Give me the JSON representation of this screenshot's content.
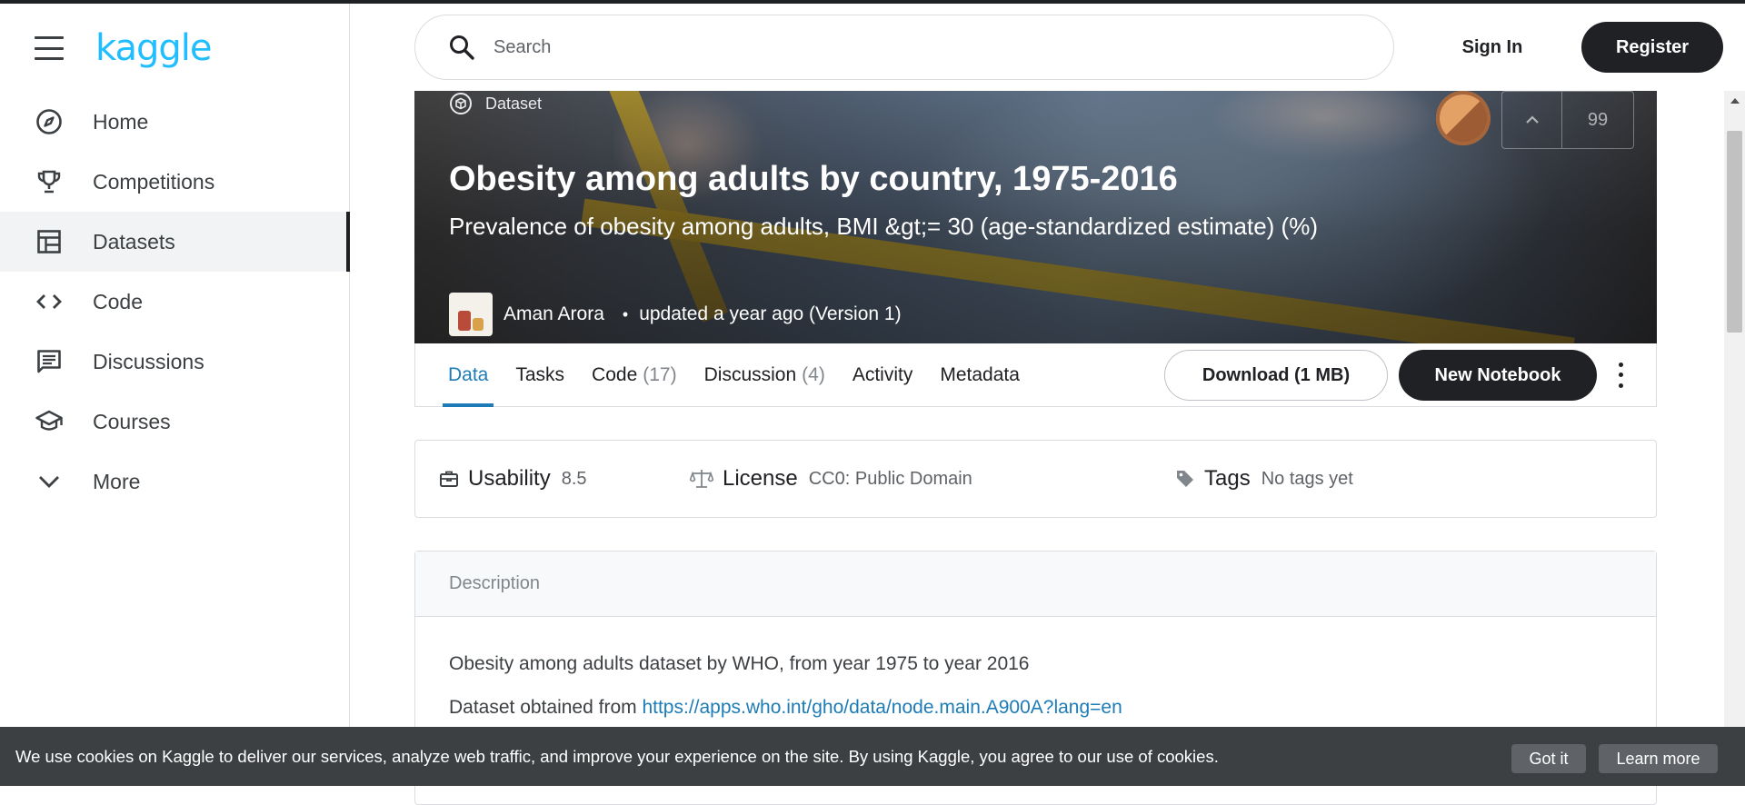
{
  "brand": {
    "logo_text": "kaggle",
    "accent": "#20beff"
  },
  "sidebar": {
    "items": [
      {
        "label": "Home",
        "icon": "compass-icon"
      },
      {
        "label": "Competitions",
        "icon": "trophy-icon"
      },
      {
        "label": "Datasets",
        "icon": "table-icon",
        "active": true
      },
      {
        "label": "Code",
        "icon": "code-icon"
      },
      {
        "label": "Discussions",
        "icon": "comment-icon"
      },
      {
        "label": "Courses",
        "icon": "school-icon"
      },
      {
        "label": "More",
        "icon": "chevron-down-icon"
      }
    ]
  },
  "header": {
    "search_placeholder": "Search",
    "sign_in_label": "Sign In",
    "register_label": "Register"
  },
  "dataset": {
    "type_label": "Dataset",
    "title": "Obesity among adults by country, 1975-2016",
    "subtitle": "Prevalence of obesity among adults, BMI &gt;= 30 (age-standardized estimate) (%)",
    "author": "Aman Arora",
    "bullet": "•",
    "updated": "updated a year ago (Version 1)",
    "medal": "bronze-medal-icon",
    "votes": "99"
  },
  "tabs": [
    {
      "label": "Data",
      "count": "",
      "active": true
    },
    {
      "label": "Tasks",
      "count": ""
    },
    {
      "label": "Code",
      "count": "(17)"
    },
    {
      "label": "Discussion",
      "count": "(4)"
    },
    {
      "label": "Activity",
      "count": ""
    },
    {
      "label": "Metadata",
      "count": ""
    }
  ],
  "actions": {
    "download_label": "Download (1 MB)",
    "notebook_label": "New Notebook"
  },
  "info": {
    "usability_label": "Usability",
    "usability_value": "8.5",
    "license_label": "License",
    "license_value": "CC0: Public Domain",
    "tags_label": "Tags",
    "tags_value": "No tags yet"
  },
  "description": {
    "heading": "Description",
    "line1": "Obesity among adults dataset by WHO, from year 1975 to year 2016",
    "line2_prefix": "Dataset obtained from ",
    "line2_link": "https://apps.who.int/gho/data/node.main.A900A?lang=en"
  },
  "cookie": {
    "text": "We use cookies on Kaggle to deliver our services, analyze web traffic, and improve your experience on the site. By using Kaggle, you agree to our use of cookies.",
    "got_it_label": "Got it",
    "learn_more_label": "Learn more"
  }
}
